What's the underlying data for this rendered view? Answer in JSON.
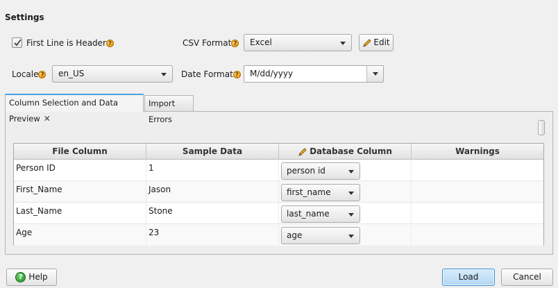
{
  "settings": {
    "title": "Settings",
    "first_line_header_label": "First Line is Header",
    "first_line_header_checked": true,
    "csv_format_label": "CSV Format",
    "csv_format_value": "Excel",
    "edit_label": "Edit",
    "locale_label": "Locale",
    "locale_value": "en_US",
    "date_format_label": "Date Format",
    "date_format_value": "M/dd/yyyy",
    "help_glyph": "?"
  },
  "tabs": [
    {
      "label": "Column Selection and Data Preview",
      "active": true,
      "close_glyph": "✕"
    },
    {
      "label": "Import Errors",
      "active": false
    }
  ],
  "table": {
    "columns": [
      "File Column",
      "Sample Data",
      "Database Column",
      "Warnings"
    ],
    "rows": [
      {
        "file_column": "Person ID",
        "sample": "1",
        "db_column": "person id",
        "warning": ""
      },
      {
        "file_column": "First_Name",
        "sample": "Jason",
        "db_column": "first_name",
        "warning": ""
      },
      {
        "file_column": "Last_Name",
        "sample": "Stone",
        "db_column": "last_name",
        "warning": ""
      },
      {
        "file_column": "Age",
        "sample": "23",
        "db_column": "age",
        "warning": ""
      }
    ]
  },
  "footer": {
    "help_label": "Help",
    "load_label": "Load",
    "cancel_label": "Cancel"
  },
  "colors": {
    "accent": "#4aa0e0",
    "default_button": "#b4d7f3",
    "help_icon": "#1f8a1f",
    "info_icon": "#e08a00"
  },
  "icons": {
    "checkbox": "check-icon",
    "edit": "pencil-icon",
    "help": "help-circle-icon",
    "info": "question-badge-icon"
  }
}
